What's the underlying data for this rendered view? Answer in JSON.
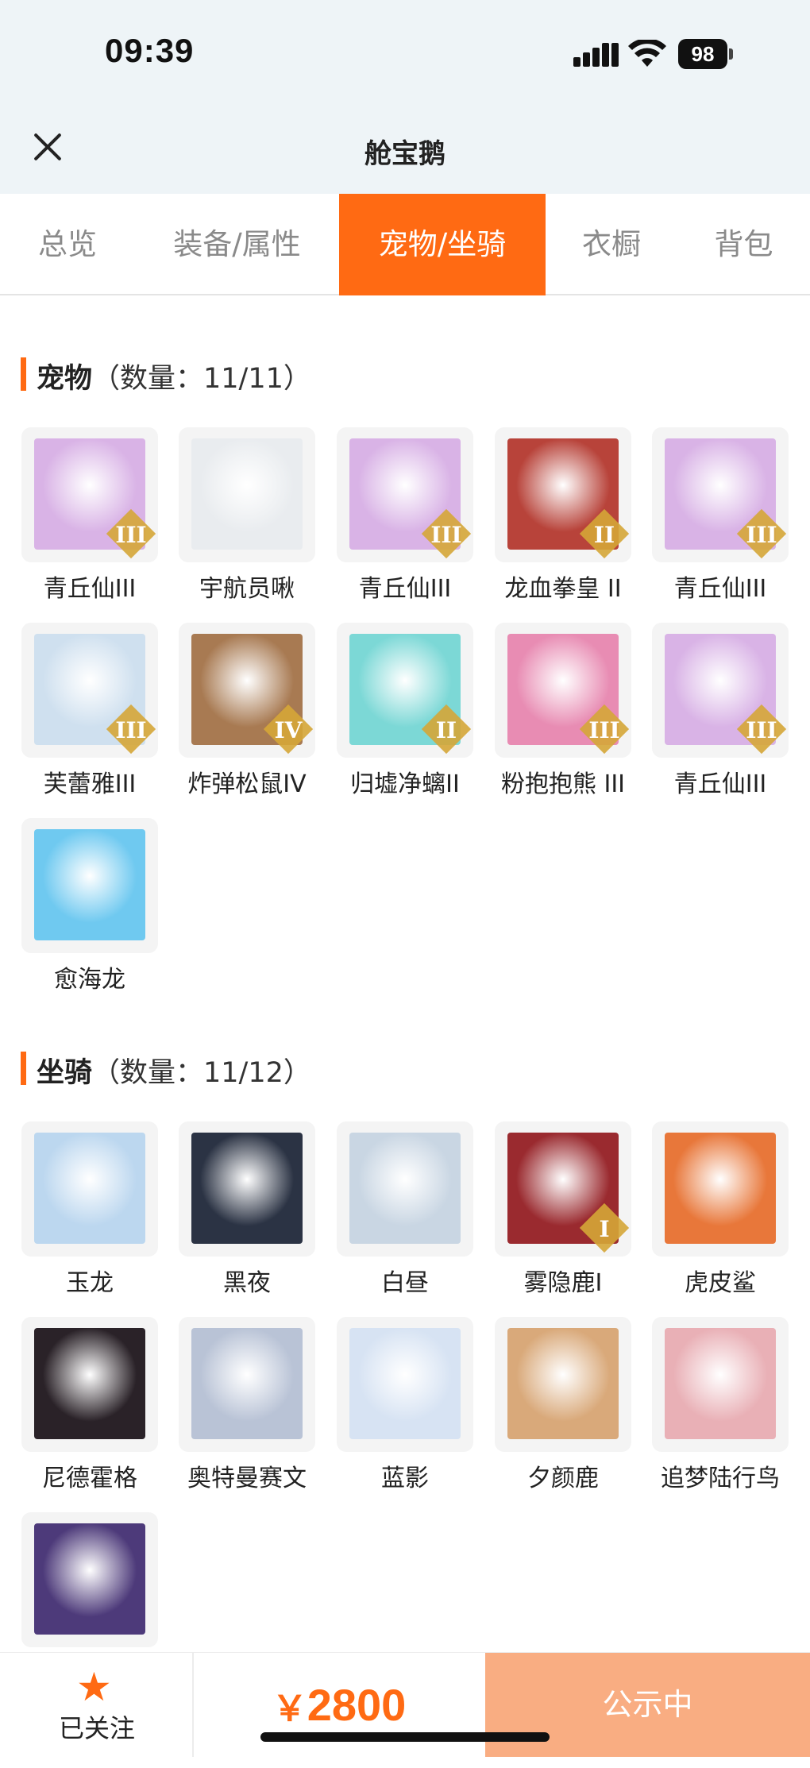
{
  "status_bar": {
    "time": "09:39",
    "battery": "98"
  },
  "header": {
    "title": "舱宝鹅"
  },
  "tabs": [
    {
      "label": "总览",
      "active": false
    },
    {
      "label": "装备/属性",
      "active": false
    },
    {
      "label": "宠物/坐骑",
      "active": true
    },
    {
      "label": "衣橱",
      "active": false
    },
    {
      "label": "背包",
      "active": false
    }
  ],
  "pets": {
    "title": "宠物",
    "count_text": "（数量：11/11）",
    "items": [
      {
        "name": "青丘仙III",
        "tier": "III",
        "color": "#d9b3e6"
      },
      {
        "name": "宇航员啾",
        "tier": "",
        "color": "#e9ecef"
      },
      {
        "name": "青丘仙III",
        "tier": "III",
        "color": "#d9b3e6"
      },
      {
        "name": "龙血拳皇 II",
        "tier": "II",
        "color": "#b8433a"
      },
      {
        "name": "青丘仙III",
        "tier": "III",
        "color": "#d9b3e6"
      },
      {
        "name": "芙蕾雅III",
        "tier": "III",
        "color": "#cfe0ef"
      },
      {
        "name": "炸弹松鼠IV",
        "tier": "IV",
        "color": "#a87a52"
      },
      {
        "name": "归墟净螭II",
        "tier": "II",
        "color": "#7cd8d6"
      },
      {
        "name": "粉抱抱熊 III",
        "tier": "III",
        "color": "#e88cb3"
      },
      {
        "name": "青丘仙III",
        "tier": "III",
        "color": "#d9b3e6"
      },
      {
        "name": "愈海龙",
        "tier": "",
        "color": "#6fc9f0"
      }
    ]
  },
  "mounts": {
    "title": "坐骑",
    "count_text": "（数量：11/12）",
    "items": [
      {
        "name": "玉龙",
        "tier": "",
        "color": "#bcd7ef"
      },
      {
        "name": "黑夜",
        "tier": "",
        "color": "#2b3344"
      },
      {
        "name": "白昼",
        "tier": "",
        "color": "#c9d6e3"
      },
      {
        "name": "雾隐鹿I",
        "tier": "I",
        "color": "#9a2a2f"
      },
      {
        "name": "虎皮鲨",
        "tier": "",
        "color": "#e8773a"
      },
      {
        "name": "尼德霍格",
        "tier": "",
        "color": "#2a2228"
      },
      {
        "name": "奥特曼赛文",
        "tier": "",
        "color": "#b9c3d6"
      },
      {
        "name": "蓝影",
        "tier": "",
        "color": "#d7e3f3"
      },
      {
        "name": "夕颜鹿",
        "tier": "",
        "color": "#d9a97a"
      },
      {
        "name": "追梦陆行鸟",
        "tier": "",
        "color": "#e9b0b6"
      },
      {
        "name": "",
        "tier": "",
        "color": "#4d3a7a"
      }
    ]
  },
  "bottom_bar": {
    "follow_label": "已关注",
    "currency": "￥",
    "price": "2800",
    "action_label": "公示中"
  },
  "colors": {
    "accent": "#ff6a13",
    "action_button": "#f9ad82",
    "header_bg": "#eef4f7"
  }
}
